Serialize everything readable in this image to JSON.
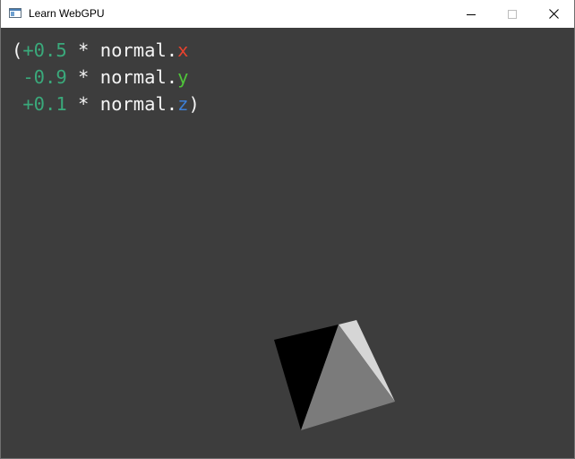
{
  "window": {
    "title": "Learn WebGPU",
    "app_icon": "window-app-icon",
    "controls": {
      "minimize_icon": "minimize-icon",
      "maximize_icon": "maximize-icon",
      "close_icon": "close-icon"
    }
  },
  "overlay": {
    "lines": [
      {
        "open": "(",
        "coef": "+0.5",
        "op": " * ",
        "field": "normal.",
        "comp": "x",
        "close": ""
      },
      {
        "open": " ",
        "coef": "-0.9",
        "op": " * ",
        "field": "normal.",
        "comp": "y",
        "close": ""
      },
      {
        "open": " ",
        "coef": "+0.1",
        "op": " * ",
        "field": "normal.",
        "comp": "z",
        "close": ")"
      }
    ]
  },
  "colors": {
    "canvas_background": "#3d3d3d",
    "text": "#f4f4f4",
    "coefficient": "#3aa97b",
    "x": "#e8422e",
    "y": "#4fc43a",
    "z": "#3d7fd6",
    "face_left": "#000000",
    "face_front": "#7b7b7b",
    "face_right": "#d6d6d6"
  }
}
